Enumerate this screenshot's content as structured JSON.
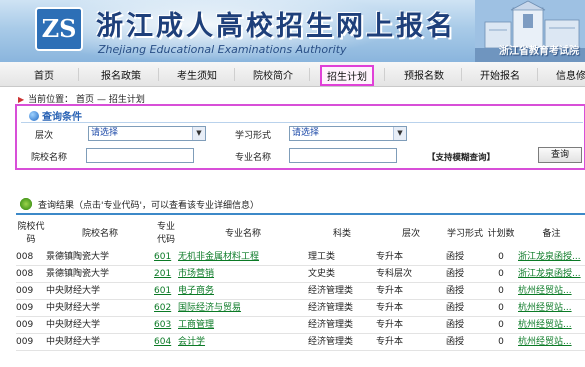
{
  "header": {
    "logo_text": "ZS",
    "title": "浙江成人高校招生网上报名",
    "subtitle": "Zhejiang Educational Examinations Authority",
    "org": "浙江省教育考试院"
  },
  "nav": {
    "items": [
      {
        "label": "首页"
      },
      {
        "label": "报名政策"
      },
      {
        "label": "考生须知"
      },
      {
        "label": "院校简介"
      },
      {
        "label": "招生计划",
        "active": true
      },
      {
        "label": "预报名数"
      },
      {
        "label": "开始报名"
      },
      {
        "label": "信息修"
      }
    ]
  },
  "breadcrumb": {
    "label": "当前位置：",
    "home": "首页",
    "sep": "—",
    "current": "招生计划"
  },
  "query": {
    "title": "查询条件",
    "level_label": "层次",
    "level_value": "请选择",
    "form_label": "学习形式",
    "form_value": "请选择",
    "school_label": "院校名称",
    "school_value": "",
    "major_label": "专业名称",
    "major_value": "",
    "hint": "【支持模糊查询】",
    "button": "查询"
  },
  "results": {
    "title": "查询结果（点击'专业代码'，可以查看该专业详细信息）",
    "columns": [
      "院校代码",
      "院校名称",
      "专业代码",
      "专业名称",
      "科类",
      "层次",
      "学习形式",
      "计划数",
      "备注"
    ],
    "rows": [
      [
        "008",
        "景德镇陶瓷大学",
        "601",
        "无机非金属材料工程",
        "理工类",
        "专升本",
        "函授",
        "0",
        "浙江龙泉函授..."
      ],
      [
        "008",
        "景德镇陶瓷大学",
        "201",
        "市场营销",
        "文史类",
        "专科层次",
        "函授",
        "0",
        "浙江龙泉函授..."
      ],
      [
        "009",
        "中央财经大学",
        "601",
        "电子商务",
        "经济管理类",
        "专升本",
        "函授",
        "0",
        "杭州经贸站..."
      ],
      [
        "009",
        "中央财经大学",
        "602",
        "国际经济与贸易",
        "经济管理类",
        "专升本",
        "函授",
        "0",
        "杭州经贸站..."
      ],
      [
        "009",
        "中央财经大学",
        "603",
        "工商管理",
        "经济管理类",
        "专升本",
        "函授",
        "0",
        "杭州经贸站..."
      ],
      [
        "009",
        "中央财经大学",
        "604",
        "会计学",
        "经济管理类",
        "专升本",
        "函授",
        "0",
        "杭州经贸站..."
      ]
    ]
  },
  "colors": {
    "accent_link": "#0b7a26",
    "highlight": "#d84fd8",
    "banner_title": "#1e3f7a"
  }
}
